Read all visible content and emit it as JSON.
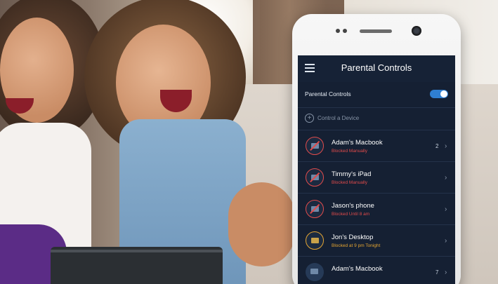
{
  "screen": {
    "title": "Parental Controls",
    "toggle": {
      "label": "Parental Controls",
      "on": true
    },
    "control_device_label": "Control a Device",
    "devices": [
      {
        "name": "Adam's Macbook",
        "status": "Blocked Manually",
        "count": "2",
        "state": "blocked"
      },
      {
        "name": "Timmy's iPad",
        "status": "Blocked Manually",
        "count": "",
        "state": "blocked"
      },
      {
        "name": "Jason's phone",
        "status": "Blocked Until 8 am",
        "count": "",
        "state": "blocked"
      },
      {
        "name": "Jon's Desktop",
        "status": "Blocked at 9 pm Tonight",
        "count": "",
        "state": "scheduled"
      },
      {
        "name": "Adam's Macbook",
        "status": "",
        "count": "7",
        "state": "normal"
      }
    ]
  },
  "colors": {
    "screen_bg": "#152033",
    "accent": "#2f7fd1",
    "blocked": "#e14b4b",
    "scheduled": "#e5a532"
  }
}
